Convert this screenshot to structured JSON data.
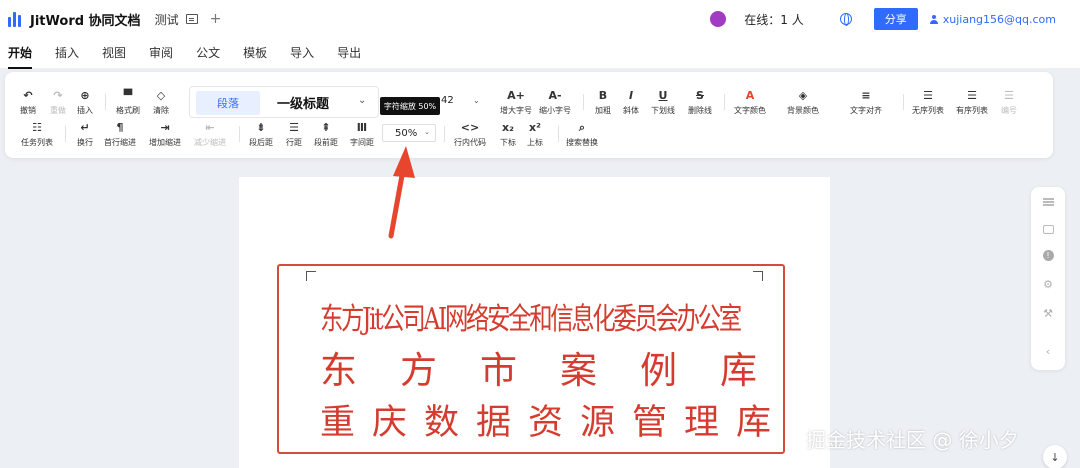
{
  "header": {
    "app_title": "JitWord 协同文档",
    "doc_name": "测试",
    "add_tab": "+",
    "online": "在线：1 人",
    "share": "分享",
    "user_email": "xujiang156@qq.com"
  },
  "menu": {
    "tabs": [
      "开始",
      "插入",
      "视图",
      "审阅",
      "公文",
      "模板",
      "导入",
      "导出"
    ],
    "active": "开始"
  },
  "toolbar": {
    "row1": {
      "undo": "撤销",
      "redo": "重做",
      "insert": "插入",
      "format_painter": "格式刷",
      "clear": "清除",
      "style_paragraph": "段落",
      "style_heading": "一级标题",
      "font_size": "42",
      "increase_font": "增大字号",
      "decrease_font": "缩小字号",
      "bold": "加粗",
      "italic": "斜体",
      "underline": "下划线",
      "strike": "删除线",
      "text_color": "文字颜色",
      "bg_color": "背景颜色",
      "text_align": "文字对齐",
      "unordered_list": "无序列表",
      "ordered_list": "有序列表",
      "numbering": "编号"
    },
    "row2": {
      "task_list": "任务列表",
      "line_break": "换行",
      "first_indent": "首行缩进",
      "increase_indent": "增加缩进",
      "decrease_indent": "减少缩进",
      "para_after": "段后距",
      "line_spacing": "行距",
      "para_before": "段前距",
      "char_spacing": "字间距",
      "char_scale": "50%",
      "inline_code": "行内代码",
      "subscript": "下标",
      "superscript": "上标",
      "search_replace": "搜索替换"
    },
    "tooltip": "字符缩放 50%"
  },
  "document": {
    "seal_lines": [
      "东方Jit公司AI网络安全和信息化委员会办公室",
      "东方市案例库",
      "重庆数据资源管理库"
    ]
  },
  "watermark": "掘金技术社区 @ 徐小夕",
  "colors": {
    "accent": "#2f6bff",
    "seal_red": "#d43c2f",
    "arrow_red": "#e8452e"
  }
}
